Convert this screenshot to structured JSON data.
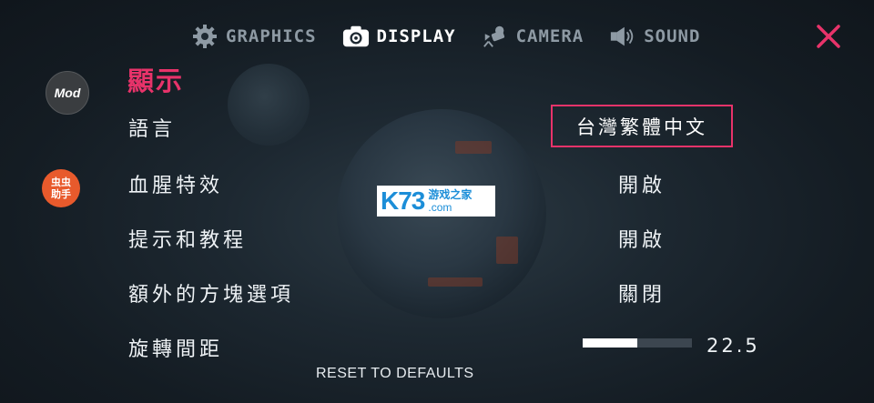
{
  "tabs": [
    {
      "label": "GRAPHICS",
      "icon": "gear-icon",
      "active": false
    },
    {
      "label": "DISPLAY",
      "icon": "camera-icon",
      "active": true
    },
    {
      "label": "CAMERA",
      "icon": "movie-camera-icon",
      "active": false
    },
    {
      "label": "SOUND",
      "icon": "speaker-icon",
      "active": false
    }
  ],
  "side": {
    "mod_label": "Mod",
    "chong_label": "虫虫\n助手"
  },
  "section": {
    "title": "顯示"
  },
  "settings": [
    {
      "label": "語言",
      "value": "台灣繁體中文"
    },
    {
      "label": "血腥特效",
      "value": "開啟"
    },
    {
      "label": "提示和教程",
      "value": "開啟"
    },
    {
      "label": "額外的方塊選項",
      "value": "關閉"
    },
    {
      "label": "旋轉間距",
      "value": "22.5",
      "slider_fraction": 0.5
    }
  ],
  "footer": {
    "reset_label": "RESET TO DEFAULTS"
  },
  "watermark": {
    "brand": "K73",
    "cn": "游戏之家",
    "domain": ".com"
  },
  "colors": {
    "accent": "#e8336a",
    "close": "#e8336a",
    "tab_inactive": "#8e9aa4"
  }
}
